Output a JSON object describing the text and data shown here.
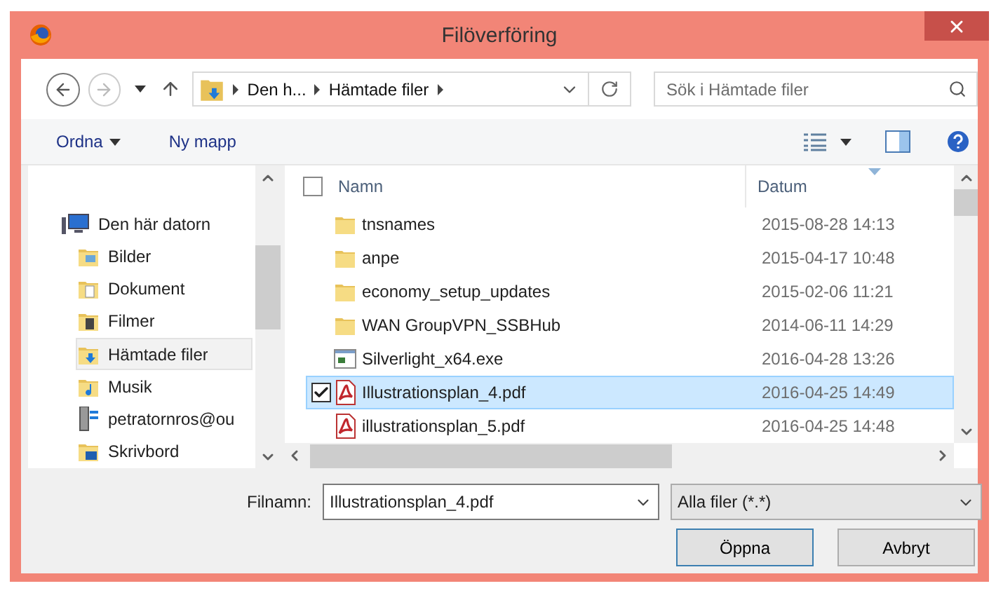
{
  "window": {
    "title": "Filöverföring"
  },
  "navigation": {
    "breadcrumbs": [
      "Den h...",
      "Hämtade filer"
    ],
    "search": {
      "placeholder": "Sök i Hämtade filer"
    }
  },
  "toolbar": {
    "organize": "Ordna",
    "new_folder": "Ny mapp"
  },
  "sidebar": {
    "items": [
      {
        "label": "Den här datorn",
        "kind": "computer",
        "selected": false,
        "children": [
          {
            "label": "Bilder",
            "kind": "pictures",
            "selected": false
          },
          {
            "label": "Dokument",
            "kind": "documents",
            "selected": false
          },
          {
            "label": "Filmer",
            "kind": "videos",
            "selected": false
          },
          {
            "label": "Hämtade filer",
            "kind": "downloads",
            "selected": true
          },
          {
            "label": "Musik",
            "kind": "music",
            "selected": false
          },
          {
            "label": "petratornros@ou",
            "kind": "network",
            "selected": false
          },
          {
            "label": "Skrivbord",
            "kind": "desktop",
            "selected": false
          }
        ]
      }
    ]
  },
  "table": {
    "select_all": {
      "checked": false
    },
    "columns": [
      "Namn",
      "Datum"
    ],
    "rows": [
      {
        "name": "tnsnames",
        "date": "2015-08-28 14:13",
        "kind": "folder",
        "selected": false,
        "checked": false
      },
      {
        "name": "anpe",
        "date": "2015-04-17 10:48",
        "kind": "folder",
        "selected": false,
        "checked": false
      },
      {
        "name": "economy_setup_updates",
        "date": "2015-02-06 11:21",
        "kind": "folder",
        "selected": false,
        "checked": false
      },
      {
        "name": "WAN GroupVPN_SSBHub",
        "date": "2014-06-11 14:29",
        "kind": "folder",
        "selected": false,
        "checked": false
      },
      {
        "name": "Silverlight_x64.exe",
        "date": "2016-04-28 13:26",
        "kind": "exe",
        "selected": false,
        "checked": false
      },
      {
        "name": "Illustrationsplan_4.pdf",
        "date": "2016-04-25 14:49",
        "kind": "pdf",
        "selected": true,
        "checked": true
      },
      {
        "name": "illustrationsplan_5.pdf",
        "date": "2016-04-25 14:48",
        "kind": "pdf",
        "selected": false,
        "checked": false
      }
    ]
  },
  "footer": {
    "filename_label": "Filnamn:",
    "filename": "Illustrationsplan_4.pdf",
    "filetype": "Alla filer (*.*)",
    "buttons": [
      {
        "label": "Öppna",
        "default": true
      },
      {
        "label": "Avbryt",
        "default": false
      }
    ]
  }
}
